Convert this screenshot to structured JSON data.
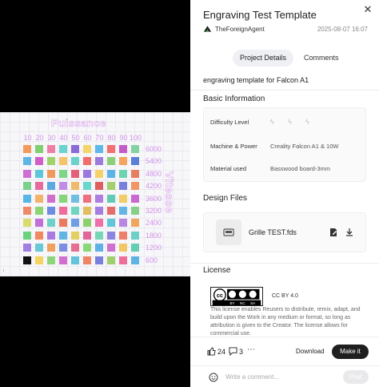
{
  "preview": {
    "title": "Puissance",
    "side_label": "Vitesse",
    "columns": [
      "10",
      "20",
      "30",
      "40",
      "50",
      "60",
      "70",
      "80",
      "90",
      "100"
    ],
    "rows": [
      "6000",
      "5400",
      "4800",
      "4200",
      "3600",
      "3200",
      "2400",
      "1800",
      "1200",
      "600"
    ],
    "corner_mark": "ˡ",
    "colors": [
      [
        "#f49a5c",
        "#82cf72",
        "#f07fa6",
        "#6bd4d0",
        "#8b6bd8",
        "#f2d56b",
        "#60b8e8",
        "#f37070",
        "#c45cc7",
        "#86d1a0"
      ],
      [
        "#5fb5e3",
        "#cf5fc6",
        "#9fd26b",
        "#f5c369",
        "#6ad2cb",
        "#ef6d6d",
        "#9d7bdb",
        "#8bcf77",
        "#f5a55e",
        "#5a7fd6"
      ],
      [
        "#cf6fd2",
        "#5cc7d8",
        "#ef9a5c",
        "#7cd685",
        "#e55f7a",
        "#9b79dc",
        "#f5d268",
        "#5eb3e6",
        "#6fd4b2",
        "#e77e61"
      ],
      [
        "#7ad18b",
        "#e86a9d",
        "#5aa9e0",
        "#c28be4",
        "#f0b96c",
        "#6ad6cc",
        "#df5f5f",
        "#a3d06a",
        "#7a7fdc",
        "#f29762"
      ],
      [
        "#58b6e6",
        "#f3b36a",
        "#d06fcb",
        "#86d57b",
        "#6fbfe0",
        "#ee7080",
        "#b07ee0",
        "#5fcbb4",
        "#f0cd66",
        "#c96ad0"
      ],
      [
        "#ef8a68",
        "#8dd572",
        "#6d8de0",
        "#f06a9a",
        "#70d5c0",
        "#e2be5e",
        "#a67ee2",
        "#e66b6b",
        "#62b6e6",
        "#88d08a"
      ],
      [
        "#d9dc6c",
        "#c270d6",
        "#6cd1c8",
        "#ec7a5e",
        "#6f9ee4",
        "#8fd06e",
        "#ef70a8",
        "#5fc6d9",
        "#b987e3",
        "#f0a65e"
      ],
      [
        "#6dd27f",
        "#f08862",
        "#a77be0",
        "#5fb6e3",
        "#e3cf62",
        "#e0669a",
        "#76d6b5",
        "#8d85dd",
        "#ee7f6c",
        "#6ed1c9"
      ],
      [
        "#a37ee1",
        "#69c8d4",
        "#efa25e",
        "#7b8ee0",
        "#e56f8f",
        "#88d87a",
        "#5fb0e6",
        "#d070cf",
        "#f2c766",
        "#67cdb5"
      ],
      [
        "#111111",
        "#f3d460",
        "#8fd57a",
        "#d16fd0",
        "#62c3da",
        "#ef8466",
        "#7a7fdd",
        "#a0cf6c",
        "#ee6f9a",
        "#5fb3e3"
      ]
    ]
  },
  "panel": {
    "title": "Engraving Test Template",
    "author": "TheForeignAgent",
    "date": "2025-08-07 16:07",
    "tabs": [
      {
        "label": "Project Details",
        "active": true
      },
      {
        "label": "Comments",
        "active": false
      }
    ],
    "description": "engraving template for Falcon A1",
    "basic_info": {
      "heading": "Basic Information",
      "difficulty_label": "Difficulty Level",
      "machine_label": "Machine & Power",
      "machine_value": "Creality Falcon A1 & 10W",
      "material_label": "Material used",
      "material_value": "Basswood board-3mm"
    },
    "design_files": {
      "heading": "Design Files",
      "file_name": "Grille TEST.fds"
    },
    "license": {
      "heading": "License",
      "name": "CC BY 4.0",
      "text": "This license enables Reusers to distribute, remix, adapt, and build upon the Work in any medium or format, so long as attribution is given to the Creator. The license allows for commercial use."
    },
    "footer": {
      "likes": "24",
      "comments": "3",
      "more": "⋯",
      "download_label": "Download",
      "make_label": "Make it"
    },
    "comment_box": {
      "placeholder": "Write a comment...",
      "post_label": "Post"
    },
    "close": "✕"
  }
}
